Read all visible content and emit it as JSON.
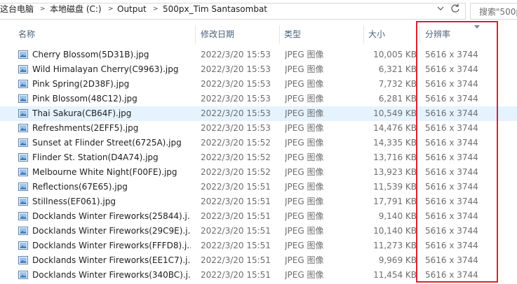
{
  "address_bar": {
    "breadcrumbs": [
      "这台电脑",
      "本地磁盘 (C:)",
      "Output",
      "500px_Tim Santasombat"
    ],
    "search_placeholder": "搜索\"500p"
  },
  "columns": {
    "name": "名称",
    "date": "修改日期",
    "type": "类型",
    "size": "大小",
    "dimensions": "分辨率"
  },
  "sorted_column": "dimensions",
  "files": [
    {
      "name": "Cherry Blossom(5D31B).jpg",
      "date": "2022/3/20 15:53",
      "type": "JPEG 图像",
      "size": "10,005 KB",
      "dim": "5616 x 3744"
    },
    {
      "name": "Wild Himalayan Cherry(C9963).jpg",
      "date": "2022/3/20 15:53",
      "type": "JPEG 图像",
      "size": "6,321 KB",
      "dim": "5616 x 3744"
    },
    {
      "name": "Pink Spring(2D38F).jpg",
      "date": "2022/3/20 15:53",
      "type": "JPEG 图像",
      "size": "7,732 KB",
      "dim": "5616 x 3744"
    },
    {
      "name": "Pink Blossom(48C12).jpg",
      "date": "2022/3/20 15:53",
      "type": "JPEG 图像",
      "size": "6,281 KB",
      "dim": "5616 x 3744"
    },
    {
      "name": "Thai Sakura(CB64F).jpg",
      "date": "2022/3/20 15:53",
      "type": "JPEG 图像",
      "size": "10,549 KB",
      "dim": "5616 x 3744",
      "selected": true
    },
    {
      "name": "Refreshments(2EFF5).jpg",
      "date": "2022/3/20 15:53",
      "type": "JPEG 图像",
      "size": "14,476 KB",
      "dim": "5616 x 3744"
    },
    {
      "name": "Sunset at Flinder Street(6725A).jpg",
      "date": "2022/3/20 15:52",
      "type": "JPEG 图像",
      "size": "14,335 KB",
      "dim": "5616 x 3744"
    },
    {
      "name": "Flinder St. Station(D4A74).jpg",
      "date": "2022/3/20 15:52",
      "type": "JPEG 图像",
      "size": "13,716 KB",
      "dim": "5616 x 3744"
    },
    {
      "name": "Melbourne White Night(F00FE).jpg",
      "date": "2022/3/20 15:52",
      "type": "JPEG 图像",
      "size": "13,923 KB",
      "dim": "5616 x 3744"
    },
    {
      "name": "Reflections(67E65).jpg",
      "date": "2022/3/20 15:51",
      "type": "JPEG 图像",
      "size": "11,539 KB",
      "dim": "5616 x 3744"
    },
    {
      "name": "Stillness(EF061).jpg",
      "date": "2022/3/20 15:51",
      "type": "JPEG 图像",
      "size": "17,791 KB",
      "dim": "5616 x 3744"
    },
    {
      "name": "Docklands Winter Fireworks(25844).j...",
      "date": "2022/3/20 15:51",
      "type": "JPEG 图像",
      "size": "9,140 KB",
      "dim": "5616 x 3744"
    },
    {
      "name": "Docklands Winter Fireworks(29C9E).j...",
      "date": "2022/3/20 15:51",
      "type": "JPEG 图像",
      "size": "10,140 KB",
      "dim": "5616 x 3744"
    },
    {
      "name": "Docklands Winter Fireworks(FFFD8).j...",
      "date": "2022/3/20 15:51",
      "type": "JPEG 图像",
      "size": "11,273 KB",
      "dim": "5616 x 3744"
    },
    {
      "name": "Docklands Winter Fireworks(EE1C7).j...",
      "date": "2022/3/20 15:51",
      "type": "JPEG 图像",
      "size": "9,969 KB",
      "dim": "5616 x 3744"
    },
    {
      "name": "Docklands Winter Fireworks(340BC).j...",
      "date": "2022/3/20 15:51",
      "type": "JPEG 图像",
      "size": "11,454 KB",
      "dim": "5616 x 3744"
    }
  ],
  "colors": {
    "selected_row": "#e5f3ff",
    "highlight_border": "#e0202a",
    "header_text": "#4c607a"
  }
}
